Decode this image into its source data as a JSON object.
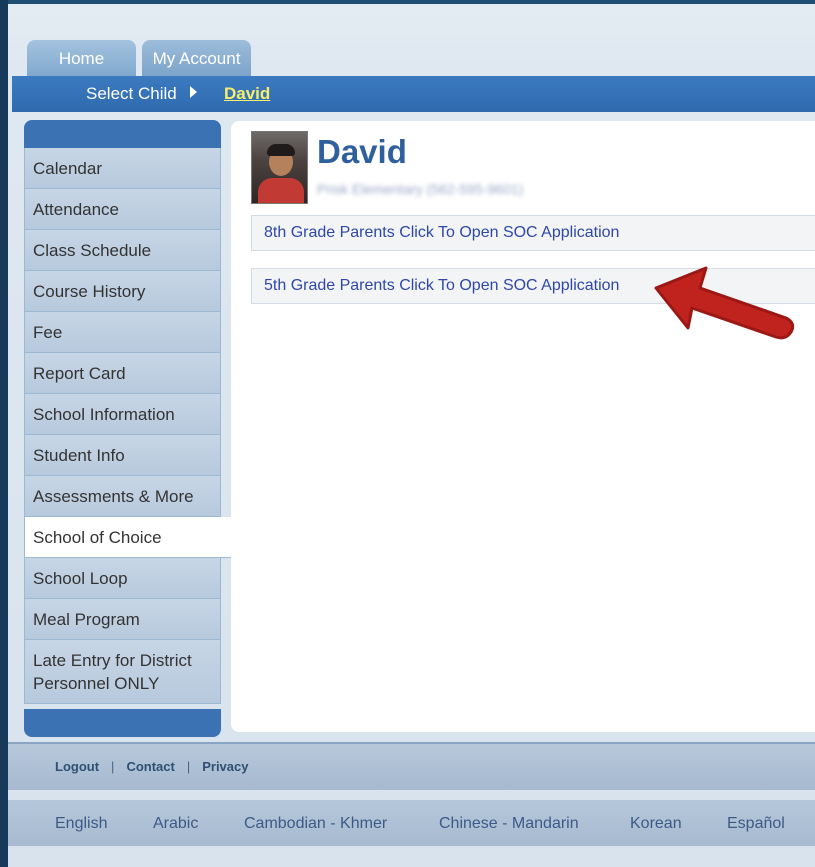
{
  "tabs": {
    "home": "Home",
    "my_account": "My Account"
  },
  "child_bar": {
    "label": "Select Child",
    "child_name": "David"
  },
  "sidebar": {
    "items": [
      "Calendar",
      "Attendance",
      "Class Schedule",
      "Course History",
      "Fee",
      "Report Card",
      "School Information",
      "Student Info",
      "Assessments & More",
      "School of Choice",
      "School Loop",
      "Meal Program",
      "Late Entry for District Personnel ONLY"
    ],
    "active": "School of Choice"
  },
  "student": {
    "name": "David",
    "school_line": "Prisk Elementary (562-595-9601)"
  },
  "links": {
    "grade8": "8th Grade Parents Click To Open SOC Application",
    "grade5": "5th Grade Parents Click To Open SOC Application"
  },
  "footer": {
    "logout": "Logout",
    "contact": "Contact",
    "privacy": "Privacy",
    "separator": "|"
  },
  "languages": [
    "English",
    "Arabic",
    "Cambodian - Khmer",
    "Chinese - Mandarin",
    "Korean",
    "Español"
  ],
  "colors": {
    "accent_blue": "#2f6aae",
    "child_link": "#f4ef6a",
    "arrow_red": "#c0221d"
  }
}
